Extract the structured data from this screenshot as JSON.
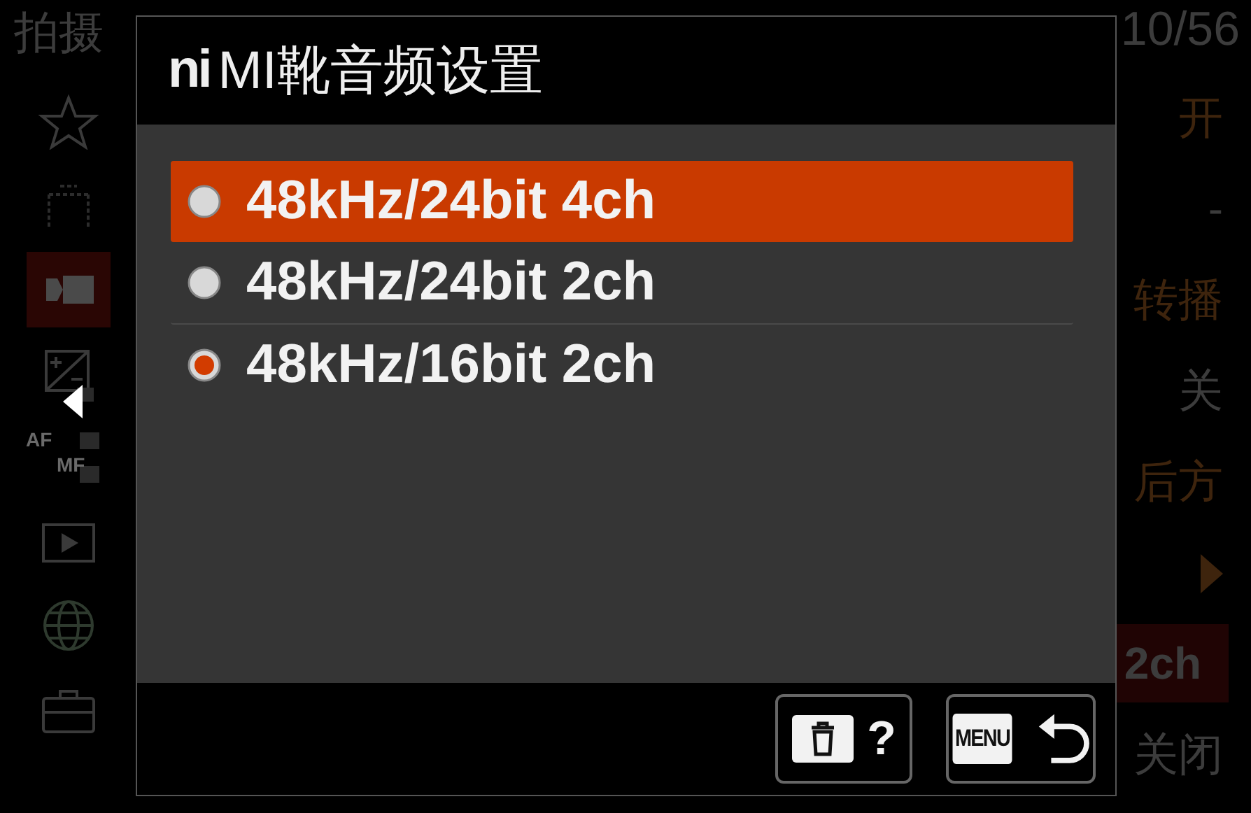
{
  "header": {
    "title": "拍摄",
    "page": "10/56"
  },
  "sidebar": {
    "items": [
      {
        "kind": "star",
        "selected": false
      },
      {
        "kind": "camera",
        "selected": false
      },
      {
        "kind": "movie",
        "selected": true
      },
      {
        "kind": "exposure",
        "selected": false
      },
      {
        "kind": "focus",
        "selected": false,
        "texts": [
          "AF",
          "MF"
        ]
      },
      {
        "kind": "play",
        "selected": false
      },
      {
        "kind": "globe",
        "selected": false
      },
      {
        "kind": "toolbox",
        "selected": false
      }
    ]
  },
  "values": [
    {
      "kind": "text",
      "text": "开",
      "accent": true
    },
    {
      "kind": "text",
      "text": "-",
      "accent": false
    },
    {
      "kind": "text",
      "text": "转播",
      "accent": true
    },
    {
      "kind": "text",
      "text": "关",
      "accent": false
    },
    {
      "kind": "text",
      "text": "后方",
      "accent": true
    },
    {
      "kind": "arrow",
      "accent": true
    },
    {
      "kind": "highlight",
      "text": "2ch",
      "accent": false
    },
    {
      "kind": "text",
      "text": "关闭",
      "accent": false
    }
  ],
  "dialog": {
    "title_prefix": "ni",
    "title": "MI靴音频设置",
    "options": [
      {
        "label": "48kHz/24bit 4ch",
        "focused": true,
        "checked": false
      },
      {
        "label": "48kHz/24bit 2ch",
        "focused": false,
        "checked": false
      },
      {
        "label": "48kHz/16bit 2ch",
        "focused": false,
        "checked": true
      }
    ],
    "buttons": [
      {
        "kind": "delete-help",
        "label": "?"
      },
      {
        "kind": "menu-back",
        "label": "MENU"
      }
    ]
  }
}
